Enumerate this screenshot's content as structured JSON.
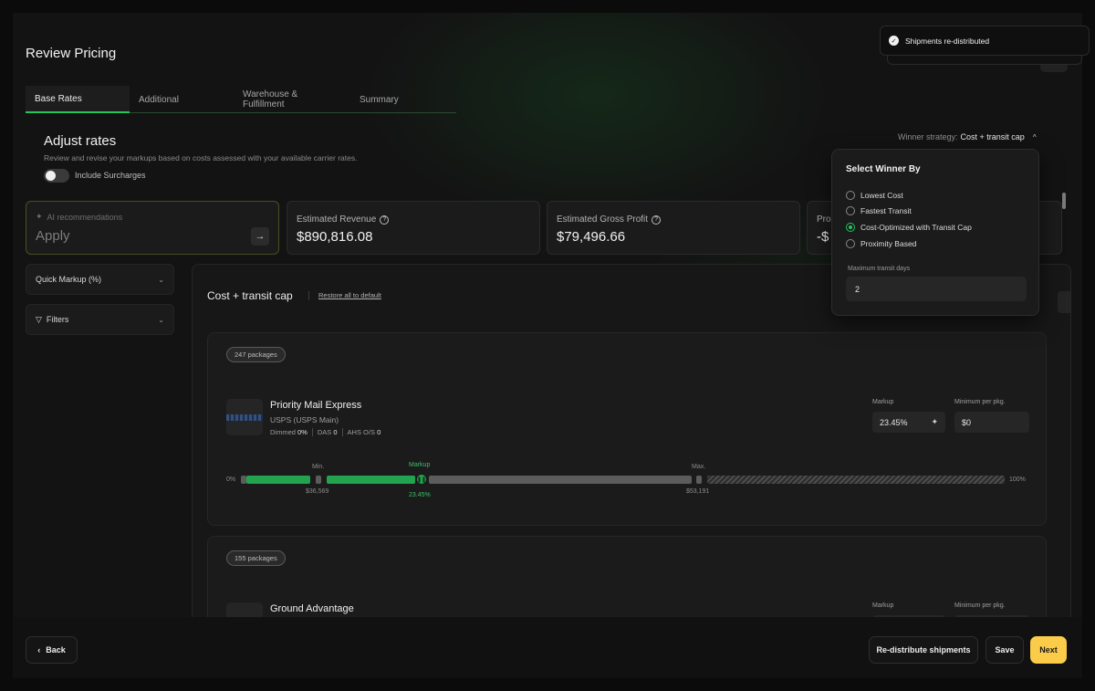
{
  "page": {
    "title": "Review Pricing"
  },
  "tabs": [
    {
      "label": "Base Rates",
      "active": true
    },
    {
      "label": "Additional"
    },
    {
      "label": "Warehouse & Fulfillment"
    },
    {
      "label": "Summary"
    }
  ],
  "adjust": {
    "title": "Adjust rates",
    "subtitle": "Review and revise your markups based on costs assessed with your available carrier rates.",
    "include_surcharges_label": "Include Surcharges",
    "include_surcharges_on": false
  },
  "strategy": {
    "label": "Winner strategy:",
    "value": "Cost + transit cap"
  },
  "cards": {
    "ai": {
      "label": "AI recommendations",
      "action": "Apply"
    },
    "revenue": {
      "label": "Estimated Revenue",
      "value": "$890,816.08"
    },
    "gross_profit": {
      "label": "Estimated Gross Profit",
      "value": "$79,496.66"
    },
    "fourth": {
      "label": "Pro",
      "value": "-$"
    }
  },
  "sidebar": {
    "quick_markup": "Quick Markup (%)",
    "filters": "Filters"
  },
  "panel": {
    "title": "Cost + transit cap",
    "restore": "Restore all to default"
  },
  "groups": [
    {
      "badge": "247 packages",
      "service": "Priority Mail Express",
      "carrier": "USPS (USPS Main)",
      "meta": {
        "dimmed_label": "Dimmed",
        "dimmed": "0%",
        "das_label": "DAS",
        "das": "0",
        "ahs_label": "AHS O/S",
        "ahs": "0"
      },
      "markup_label": "Markup",
      "markup_value": "23.45%",
      "min_label": "Minimum per pkg.",
      "min_value": "$0",
      "range": {
        "start": "0%",
        "end": "100%",
        "min_label": "Min.",
        "min_value": "$36,569",
        "markup_label": "Markup",
        "markup_value": "23.45%",
        "max_label": "Max.",
        "max_value": "$53,191"
      }
    },
    {
      "badge": "155 packages",
      "service": "Ground Advantage",
      "markup_label": "Markup",
      "min_label": "Minimum per pkg."
    }
  ],
  "toast": {
    "message": "Shipments re-distributed"
  },
  "dropdown": {
    "title": "Select Winner By",
    "options": [
      {
        "label": "Lowest Cost",
        "selected": false
      },
      {
        "label": "Fastest Transit",
        "selected": false
      },
      {
        "label": "Cost-Optimized with Transit Cap",
        "selected": true
      },
      {
        "label": "Proximity Based",
        "selected": false
      }
    ],
    "max_label": "Maximum transit days",
    "max_value": "2"
  },
  "footer": {
    "back": "Back",
    "redistribute": "Re-distribute shipments",
    "save": "Save",
    "next": "Next"
  },
  "colors": {
    "accent": "#22c55e",
    "primary_button": "#facc4a",
    "background": "#131313"
  }
}
